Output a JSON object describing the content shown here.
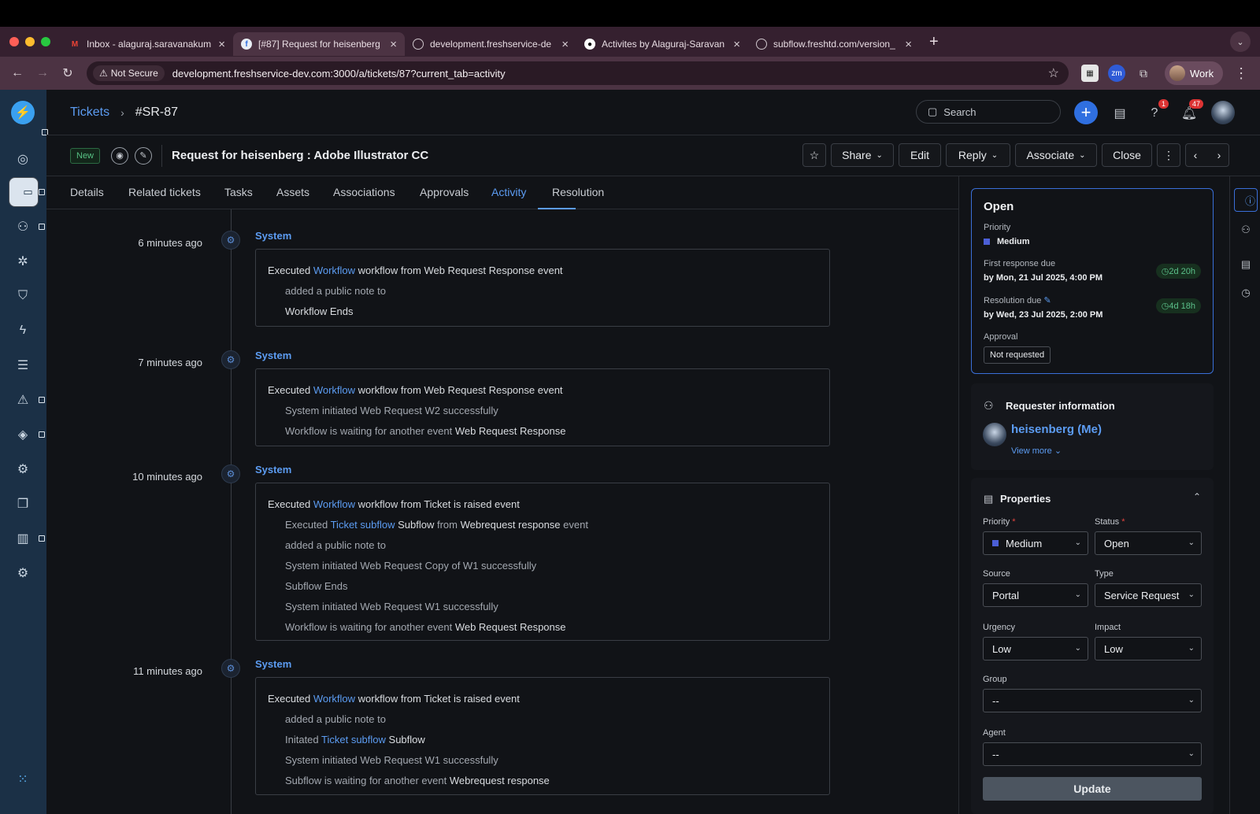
{
  "browser": {
    "tabs": [
      {
        "title": "Inbox - alaguraj.saravanakum",
        "icon": "gmail-icon"
      },
      {
        "title": "[#87] Request for heisenberg",
        "icon": "freshservice-icon"
      },
      {
        "title": "development.freshservice-de",
        "icon": "globe-icon"
      },
      {
        "title": "Activites by Alaguraj-Saravan",
        "icon": "github-icon"
      },
      {
        "title": "subflow.freshtd.com/version_",
        "icon": "globe-icon"
      }
    ],
    "not_secure": "Not Secure",
    "url": "development.freshservice-dev.com:3000/a/tickets/87?current_tab=activity",
    "profile": "Work"
  },
  "header": {
    "breadcrumb_root": "Tickets",
    "breadcrumb_id": "#SR-87",
    "search_placeholder": "Search",
    "help_badge": "1",
    "notif_badge": "47"
  },
  "ticket": {
    "status_badge": "New",
    "title": "Request for heisenberg : Adobe Illustrator CC",
    "actions": {
      "share": "Share",
      "edit": "Edit",
      "reply": "Reply",
      "associate": "Associate",
      "close": "Close"
    }
  },
  "tabs": [
    "Details",
    "Related tickets",
    "Tasks",
    "Assets",
    "Associations",
    "Approvals",
    "Activity",
    "Resolution"
  ],
  "activity": {
    "actor": "System",
    "events": [
      {
        "time": "6 minutes ago",
        "lines": [
          {
            "sub": false,
            "parts": [
              [
                "t",
                "Executed "
              ],
              [
                "l",
                "Workflow"
              ],
              [
                "t",
                " workflow from Web Request Response event"
              ]
            ]
          },
          {
            "sub": true,
            "parts": [
              [
                "t",
                "added a public note to"
              ]
            ]
          },
          {
            "sub": true,
            "parts": [
              [
                "h",
                "Workflow Ends"
              ]
            ]
          }
        ]
      },
      {
        "time": "7 minutes ago",
        "lines": [
          {
            "sub": false,
            "parts": [
              [
                "t",
                "Executed "
              ],
              [
                "l",
                "Workflow"
              ],
              [
                "t",
                " workflow from Web Request Response event"
              ]
            ]
          },
          {
            "sub": true,
            "parts": [
              [
                "t",
                "System initiated Web Request W2 successfully"
              ]
            ]
          },
          {
            "sub": true,
            "parts": [
              [
                "t",
                "Workflow is waiting for another event "
              ],
              [
                "h",
                "Web Request Response"
              ]
            ]
          }
        ]
      },
      {
        "time": "10 minutes ago",
        "lines": [
          {
            "sub": false,
            "parts": [
              [
                "t",
                "Executed "
              ],
              [
                "l",
                "Workflow"
              ],
              [
                "t",
                " workflow from Ticket is raised event"
              ]
            ]
          },
          {
            "sub": true,
            "parts": [
              [
                "t",
                "Executed "
              ],
              [
                "l",
                "Ticket subflow"
              ],
              [
                "h",
                " Subflow"
              ],
              [
                "t",
                " from "
              ],
              [
                "h",
                "Webrequest response"
              ],
              [
                "t",
                " event"
              ]
            ]
          },
          {
            "sub": true,
            "parts": [
              [
                "t",
                "added a public note to"
              ]
            ]
          },
          {
            "sub": true,
            "parts": [
              [
                "t",
                "System initiated Web Request Copy of W1 successfully"
              ]
            ]
          },
          {
            "sub": true,
            "parts": [
              [
                "t",
                "Subflow Ends"
              ]
            ]
          },
          {
            "sub": true,
            "parts": [
              [
                "t",
                "System initiated Web Request W1 successfully"
              ]
            ]
          },
          {
            "sub": true,
            "parts": [
              [
                "t",
                "Workflow is waiting for another event "
              ],
              [
                "h",
                "Web Request Response"
              ]
            ]
          }
        ]
      },
      {
        "time": "11 minutes ago",
        "lines": [
          {
            "sub": false,
            "parts": [
              [
                "t",
                "Executed "
              ],
              [
                "l",
                "Workflow"
              ],
              [
                "t",
                " workflow from Ticket is raised event"
              ]
            ]
          },
          {
            "sub": true,
            "parts": [
              [
                "t",
                "added a public note to"
              ]
            ]
          },
          {
            "sub": true,
            "parts": [
              [
                "t",
                "Initated "
              ],
              [
                "l",
                "Ticket subflow"
              ],
              [
                "h",
                " Subflow"
              ]
            ]
          },
          {
            "sub": true,
            "parts": [
              [
                "t",
                "System initiated Web Request W1 successfully"
              ]
            ]
          },
          {
            "sub": true,
            "parts": [
              [
                "t",
                "Subflow is waiting for another event "
              ],
              [
                "h",
                "Webrequest response"
              ]
            ]
          }
        ]
      }
    ]
  },
  "status_card": {
    "status": "Open",
    "priority_label": "Priority",
    "priority": "Medium",
    "first_response_label": "First response due",
    "first_response": "by Mon, 21 Jul 2025, 4:00 PM",
    "first_response_sla": "2d 20h",
    "resolution_label": "Resolution due",
    "resolution": "by Wed, 23 Jul 2025, 2:00 PM",
    "resolution_sla": "4d 18h",
    "approval_label": "Approval",
    "approval": "Not requested"
  },
  "requester": {
    "heading": "Requester information",
    "name": "heisenberg (Me)",
    "view_more": "View more"
  },
  "properties": {
    "heading": "Properties",
    "priority_label": "Priority",
    "priority": "Medium",
    "status_label": "Status",
    "status": "Open",
    "source_label": "Source",
    "source": "Portal",
    "type_label": "Type",
    "type": "Service Request",
    "urgency_label": "Urgency",
    "urgency": "Low",
    "impact_label": "Impact",
    "impact": "Low",
    "group_label": "Group",
    "group": "--",
    "agent_label": "Agent",
    "agent": "--",
    "update": "Update",
    "required_mark": "*"
  },
  "colors": {
    "accent": "#5c9cf2",
    "sidebar": "#1b3046",
    "priority_medium": "#4b5fd6",
    "sla_green": "#5bc08a"
  }
}
